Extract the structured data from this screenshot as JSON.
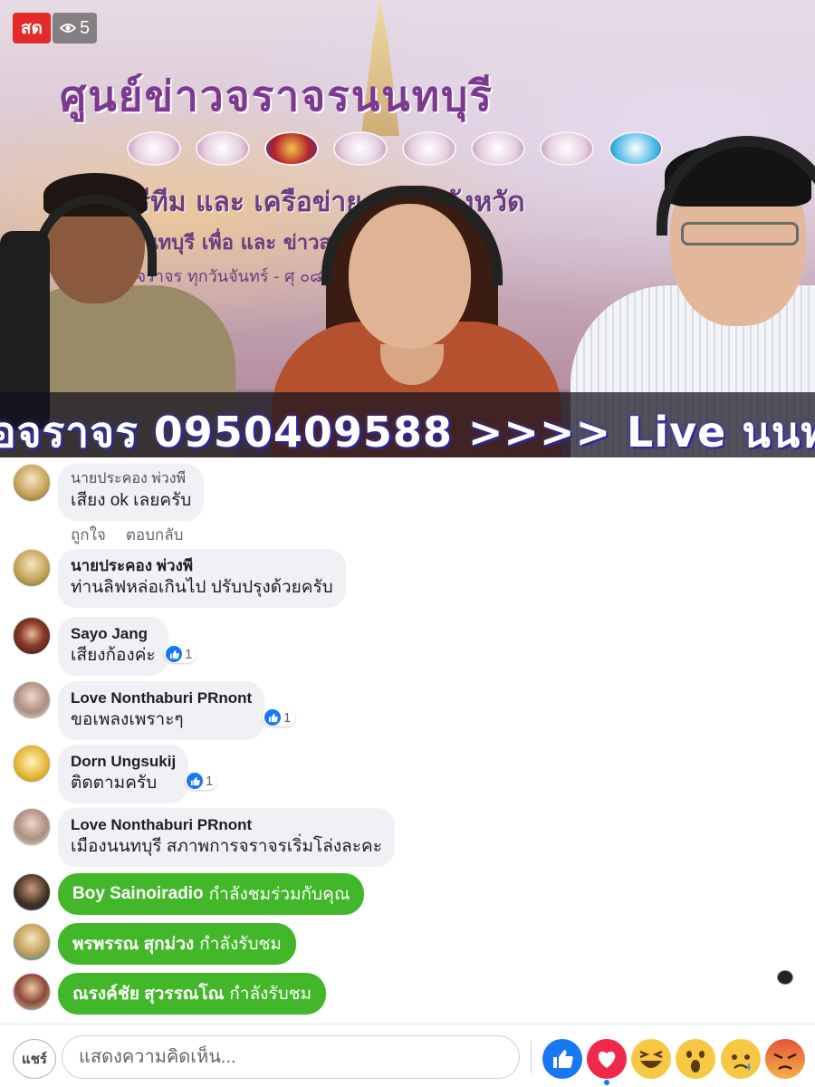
{
  "video": {
    "live_label": "สด",
    "viewer_count": "5",
    "banner_title": "ศูนย์ข่าวจราจรนนทบุรี",
    "banner_line1": "รีทีม และ เครือข่าย ชุมชนจังหวัด",
    "banner_line2": "จรนนทบุรี เพื่อ และ ข่าวสารจัง",
    "banner_line3": "การจราจร ทุกวันจันทร์ - ศุ ๐๘.๐๐ น. และ ๑๗.๐๐",
    "ticker": "อจราจร 0950409588 >>>>   Live นนท"
  },
  "comments": [
    {
      "author": "นายประคอง พ่วงพี",
      "text": "เสียง ok เลยครับ",
      "actions": {
        "like": "ถูกใจ",
        "reply": "ตอบกลับ"
      }
    },
    {
      "author": "นายประคอง พ่วงพี",
      "text": "ท่านลิฟหล่อเกินไป  ปรับปรุงด้วยครับ"
    },
    {
      "author": "Sayo Jang",
      "text": "เสียงก้องค่ะ",
      "likes": "1"
    },
    {
      "author": "Love Nonthaburi PRnont",
      "text": "ขอเพลงเพราะๆ",
      "likes": "1"
    },
    {
      "author": "Dorn Ungsukij",
      "text": "ติดตามครับ",
      "likes": "1"
    },
    {
      "author": "Love Nonthaburi PRnont",
      "text": "เมืองนนทบุรี สภาพการจราจรเริ่มโล่งละคะ"
    }
  ],
  "join_events": [
    {
      "name": "Boy Sainoiradio",
      "status": "กำลังชมร่วมกับคุณ"
    },
    {
      "name": "พรพรรณ สุกม่วง",
      "status": "กำลังรับชม"
    },
    {
      "name": "ณรงค์ชัย สุวรรณโณ",
      "status": "กำลังรับชม"
    }
  ],
  "composer": {
    "share_label": "แชร์",
    "placeholder": "แสดงความคิดเห็น..."
  },
  "colors": {
    "live_red": "#e42929",
    "join_green": "#42b72a",
    "like_blue": "#1877f2",
    "love_red": "#f0284a",
    "bubble_gray": "#eff1f4"
  },
  "reactions": [
    "like-icon",
    "love-icon",
    "haha-icon",
    "wow-icon",
    "sad-icon",
    "angry-icon"
  ]
}
